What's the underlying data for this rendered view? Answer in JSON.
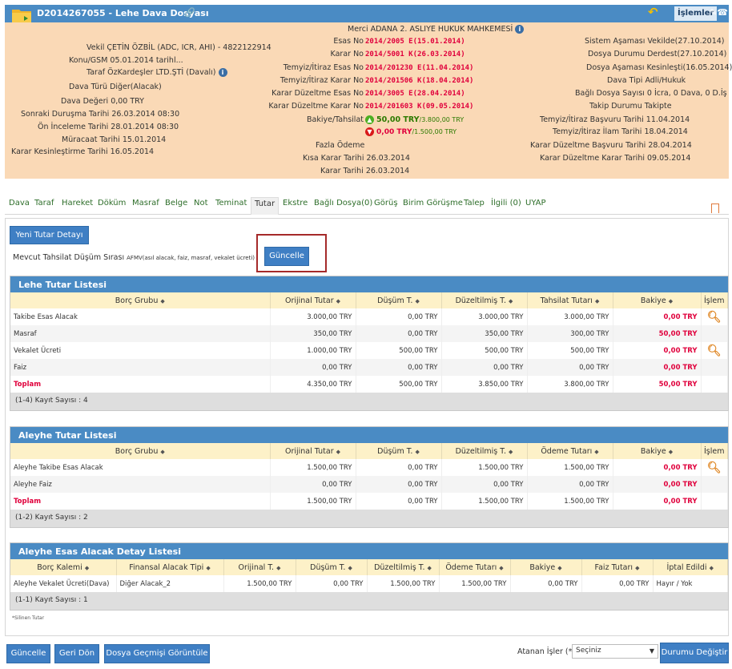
{
  "header": {
    "title": "D2014267055 - Lehe Dava Dosyası",
    "link_icon": "link-icon",
    "back_icon": "undo-arrow-icon",
    "islemler": "İşlemler",
    "edit_icon": "edit-icon",
    "phone_icon": "phone-icon"
  },
  "info": {
    "merci": "Merci ADANA 2. ASLIYE HUKUK MAHKEMESİ",
    "vekil": "Vekil ÇETİN ÖZBİL (ADC, ICR, AHI) - 4822122914",
    "konu": "Konu/GSM 05.01.2014 tarihl...",
    "taraf": "Taraf ÖzKardeşler LTD.ŞTİ (Davalı)",
    "dava_turu": "Dava Türü Diğer(Alacak)",
    "dava_degeri": "Dava Değeri 0,00 TRY",
    "sonraki": "Sonraki Duruşma Tarihi 26.03.2014 08:30",
    "on_inceleme": "Ön İnceleme Tarihi 28.01.2014 08:30",
    "muracaat": "Müracaat Tarihi 15.01.2014",
    "karar_kes": "Karar Kesinleştirme Tarihi 16.05.2014",
    "esas_no_l": "Esas No",
    "esas_no_v": "2014/2005 E(15.01.2014)",
    "karar_no_l": "Karar No",
    "karar_no_v": "2014/5001 K(26.03.2014)",
    "temyiz_esas_l": "Temyiz/İtiraz Esas No",
    "temyiz_esas_v": "2014/201230 E(11.04.2014)",
    "temyiz_karar_l": "Temyiz/İtiraz Karar No",
    "temyiz_karar_v": "2014/201506 K(18.04.2014)",
    "kd_esas_l": "Karar Düzeltme Esas No",
    "kd_esas_v": "2014/3005 E(28.04.2014)",
    "kd_karar_l": "Karar Düzeltme Karar No",
    "kd_karar_v": "2014/201603 K(09.05.2014)",
    "bakiye_l": "Bakiye/Tahsilat",
    "bakiye_v1": "50,00 TRY",
    "bakiye_v1b": "/3.800,00 TRY",
    "bakiye_v2": "0,00 TRY",
    "bakiye_v2b": "/1.500,00 TRY",
    "fazla": "Fazla Ödeme",
    "kisa": "Kısa Karar Tarihi 26.03.2014",
    "karar_t": "Karar Tarihi 26.03.2014",
    "sistem": "Sistem Aşaması Vekilde(27.10.2014)",
    "dosya_durumu": "Dosya Durumu Derdest(27.10.2014)",
    "dosya_asamasi": "Dosya Aşaması Kesinleşti(16.05.2014)",
    "dava_tipi": "Dava Tipi Adli/Hukuk",
    "bagli": "Bağlı Dosya Sayısı 0 İcra, 0 Dava, 0 D.İş",
    "takip": "Takip Durumu Takipte",
    "tb": "Temyiz/İtiraz Başvuru Tarihi 11.04.2014",
    "ti": "Temyiz/İtiraz İlam Tarihi 18.04.2014",
    "kdb": "Karar Düzeltme Başvuru Tarihi 28.04.2014",
    "kdk": "Karar Düzeltme Karar Tarihi 09.05.2014"
  },
  "tabs": [
    "Dava",
    "Taraf",
    "Hareket",
    "Döküm",
    "Masraf",
    "Belge",
    "Not",
    "Teminat",
    "Tutar",
    "Ekstre",
    "Bağlı Dosya(0)",
    "Görüş",
    "Birim Görüşme",
    "Talep",
    "İlgili (0)",
    "UYAP"
  ],
  "active_tab": "Tutar",
  "yeni_btn": "Yeni Tutar Detayı",
  "mevcut_label": "Mevcut Tahsilat Düşüm Sırası",
  "mevcut_code": "AFMV",
  "mevcut_small": "(asıl alacak, faiz, masraf, vekalet ücreti)",
  "guncelle_top": "Güncelle",
  "lehe": {
    "title": "Lehe Tutar Listesi",
    "headers": [
      "Borç Grubu",
      "Orijinal Tutar",
      "Düşüm T.",
      "Düzeltilmiş T.",
      "Tahsilat Tutarı",
      "Bakiye",
      "İşlem"
    ],
    "rows": [
      [
        "Takibe Esas Alacak",
        "3.000,00 TRY",
        "0,00 TRY",
        "3.000,00 TRY",
        "3.000,00 TRY",
        "0,00 TRY"
      ],
      [
        "Masraf",
        "350,00 TRY",
        "0,00 TRY",
        "350,00 TRY",
        "300,00 TRY",
        "50,00 TRY"
      ],
      [
        "Vekalet Ücreti",
        "1.000,00 TRY",
        "500,00 TRY",
        "500,00 TRY",
        "500,00 TRY",
        "0,00 TRY"
      ],
      [
        "Faiz",
        "0,00 TRY",
        "0,00 TRY",
        "0,00 TRY",
        "0,00 TRY",
        "0,00 TRY"
      ]
    ],
    "total": [
      "Toplam",
      "4.350,00 TRY",
      "500,00 TRY",
      "3.850,00 TRY",
      "3.800,00 TRY",
      "50,00 TRY"
    ],
    "footer": "(1-4) Kayıt Sayısı : 4"
  },
  "aleyhe": {
    "title": "Aleyhe Tutar Listesi",
    "headers": [
      "Borç Grubu",
      "Orijinal Tutar",
      "Düşüm T.",
      "Düzeltilmiş T.",
      "Ödeme Tutarı",
      "Bakiye",
      "İşlem"
    ],
    "rows": [
      [
        "Aleyhe Takibe Esas Alacak",
        "1.500,00 TRY",
        "0,00 TRY",
        "1.500,00 TRY",
        "1.500,00 TRY",
        "0,00 TRY"
      ],
      [
        "Aleyhe Faiz",
        "0,00 TRY",
        "0,00 TRY",
        "0,00 TRY",
        "0,00 TRY",
        "0,00 TRY"
      ]
    ],
    "total": [
      "Toplam",
      "1.500,00 TRY",
      "0,00 TRY",
      "1.500,00 TRY",
      "1.500,00 TRY",
      "0,00 TRY"
    ],
    "footer": "(1-2) Kayıt Sayısı : 2"
  },
  "detay": {
    "title": "Aleyhe Esas Alacak Detay Listesi",
    "headers": [
      "Borç Kalemi",
      "Finansal Alacak Tipi",
      "Orijinal T.",
      "Düşüm T.",
      "Düzeltilmiş T.",
      "Ödeme Tutarı",
      "Bakiye",
      "Faiz Tutarı",
      "İptal Edildi"
    ],
    "row": [
      "Aleyhe Vekalet Ücreti(Dava)",
      "Diğer Alacak_2",
      "1.500,00 TRY",
      "0,00 TRY",
      "1.500,00 TRY",
      "1.500,00 TRY",
      "0,00 TRY",
      "0,00 TRY",
      "Hayır / Yok"
    ],
    "footer": "(1-1) Kayıt Sayısı : 1"
  },
  "silinen": "*Silinen Tutar",
  "bottom": {
    "guncelle": "Güncelle",
    "geri": "Geri Dön",
    "gecmis": "Dosya Geçmişi Görüntüle",
    "atanan": "Atanan İşler (*)",
    "secim": "Seçiniz",
    "durum": "Durumu Değiştir"
  }
}
